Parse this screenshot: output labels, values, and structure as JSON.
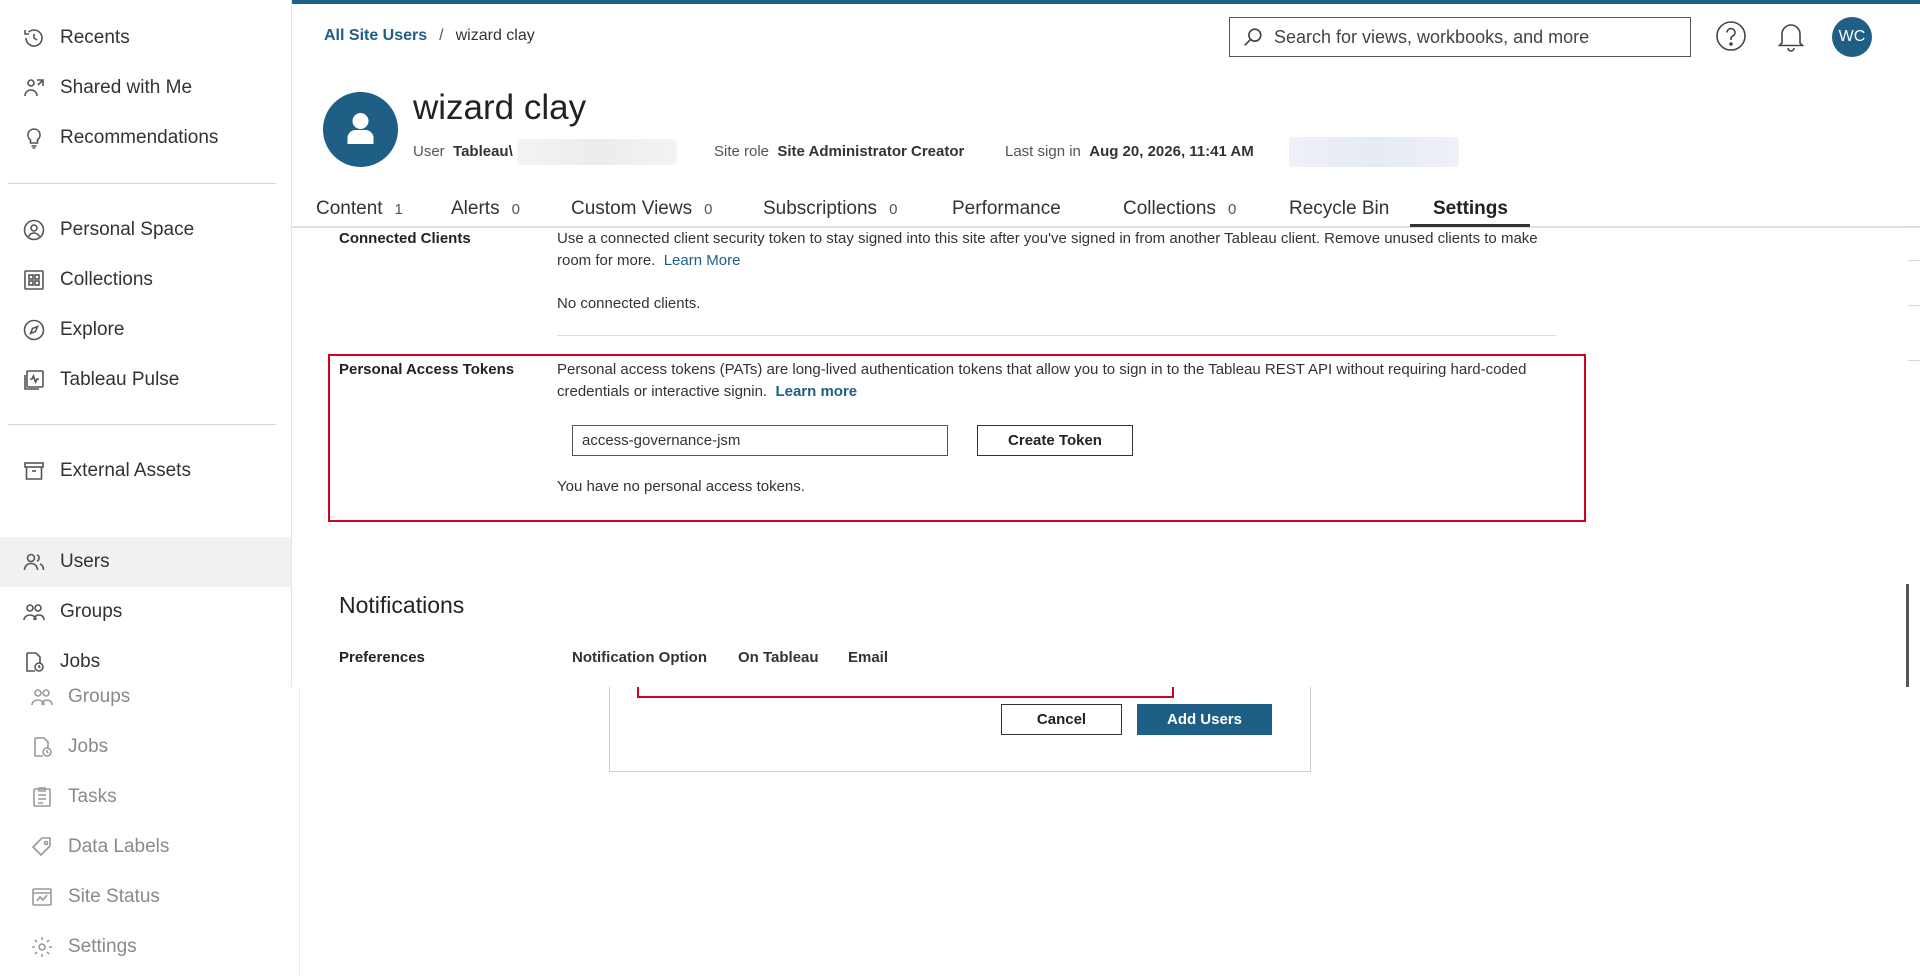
{
  "background": {
    "sidebar_items": [
      {
        "label": "Groups",
        "icon": "groups-icon"
      },
      {
        "label": "Jobs",
        "icon": "jobs-icon"
      },
      {
        "label": "Tasks",
        "icon": "tasks-icon"
      },
      {
        "label": "Data Labels",
        "icon": "data-labels-icon"
      },
      {
        "label": "Site Status",
        "icon": "site-status-icon"
      },
      {
        "label": "Settings",
        "icon": "settings-icon"
      }
    ],
    "dialog": {
      "cancel_label": "Cancel",
      "add_users_label": "Add Users"
    }
  },
  "sidebar": {
    "items": [
      {
        "label": "Recents",
        "icon": "recents-icon"
      },
      {
        "label": "Shared with Me",
        "icon": "shared-icon"
      },
      {
        "label": "Recommendations",
        "icon": "lightbulb-icon"
      },
      {
        "label": "Personal Space",
        "icon": "person-icon"
      },
      {
        "label": "Collections",
        "icon": "collections-icon"
      },
      {
        "label": "Explore",
        "icon": "explore-icon"
      },
      {
        "label": "Tableau Pulse",
        "icon": "pulse-icon"
      },
      {
        "label": "External Assets",
        "icon": "external-assets-icon"
      },
      {
        "label": "Users",
        "icon": "users-icon"
      },
      {
        "label": "Groups",
        "icon": "groups-icon"
      },
      {
        "label": "Jobs",
        "icon": "jobs-icon"
      }
    ]
  },
  "header": {
    "breadcrumb_link": "All Site Users",
    "breadcrumb_sep": "/",
    "breadcrumb_current": "wizard clay",
    "search_placeholder": "Search for views, workbooks, and more",
    "avatar_initials": "WC"
  },
  "profile": {
    "name": "wizard clay",
    "user_label": "User",
    "user_value": "Tableau\\",
    "site_role_label": "Site role",
    "site_role_value": "Site Administrator Creator",
    "last_sign_in_label": "Last sign in",
    "last_sign_in_value": "Aug 20, 2026, 11:41 AM"
  },
  "tabs": [
    {
      "label": "Content",
      "count": "1"
    },
    {
      "label": "Alerts",
      "count": "0"
    },
    {
      "label": "Custom Views",
      "count": "0"
    },
    {
      "label": "Subscriptions",
      "count": "0"
    },
    {
      "label": "Performance",
      "count": ""
    },
    {
      "label": "Collections",
      "count": "0"
    },
    {
      "label": "Recycle Bin",
      "count": ""
    },
    {
      "label": "Settings",
      "count": ""
    }
  ],
  "connected_clients": {
    "label": "Connected Clients",
    "description": "Use a connected client security token to stay signed into this site after you've signed in from another Tableau client. Remove unused clients to make room for more.",
    "learn_more": "Learn More",
    "empty_text": "No connected clients."
  },
  "pat": {
    "label": "Personal Access Tokens",
    "description": "Personal access tokens (PATs) are long-lived authentication tokens that allow you to sign in to the Tableau REST API without requiring hard-coded credentials or interactive signin.",
    "learn_more": "Learn more",
    "token_name_value": "access-governance-jsm",
    "create_label": "Create Token",
    "empty_text": "You have no personal access tokens."
  },
  "notifications": {
    "title": "Notifications",
    "preferences_label": "Preferences",
    "columns": [
      "Notification Option",
      "On Tableau",
      "Email"
    ]
  },
  "colors": {
    "accent": "#1f5f85",
    "highlight_border": "#d0021b"
  }
}
